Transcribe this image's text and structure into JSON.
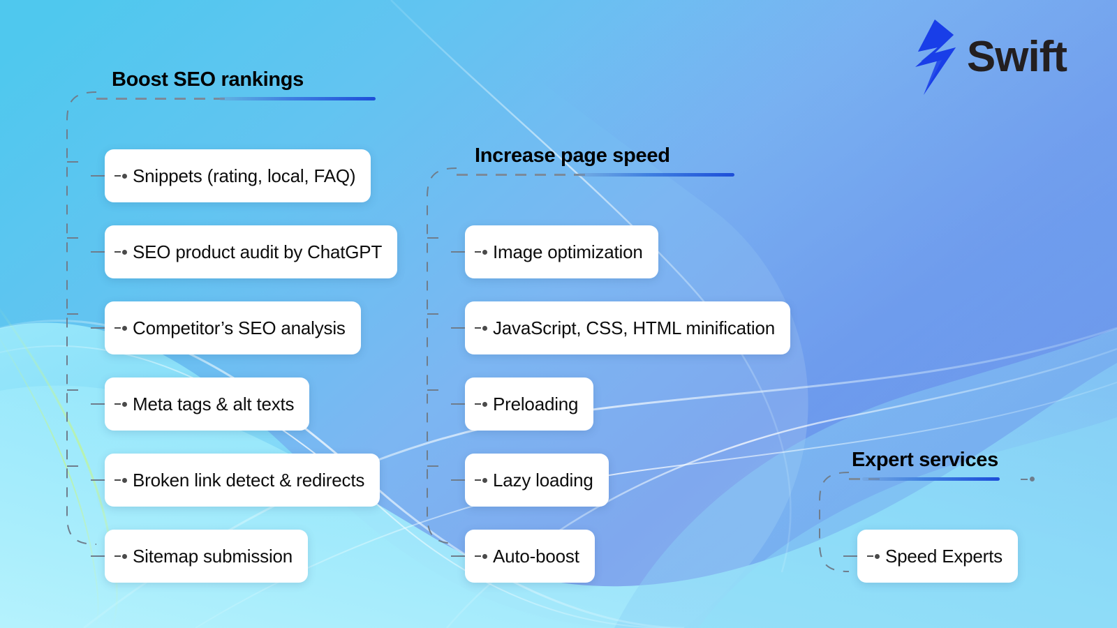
{
  "brand": {
    "name": "Swift",
    "logo_icon": "lightning-bolt-icon",
    "bolt_color": "#1A3EE8",
    "wordmark_color": "#231f20"
  },
  "theme": {
    "background_top_left": "#57C9EC",
    "background_bottom_left": "#A8ECFA",
    "background_right": "#7FAEEE",
    "accent_blue": "#1d4ed8",
    "card_background": "#FFFFFF",
    "text_color": "#0d0d0d",
    "connector_color": "#6f7d8c"
  },
  "groups": [
    {
      "id": "boost-seo-rankings",
      "title": "Boost SEO rankings",
      "items": [
        {
          "label": "Snippets (rating, local, FAQ)"
        },
        {
          "label": "SEO product audit by ChatGPT"
        },
        {
          "label": "Competitor’s SEO analysis"
        },
        {
          "label": "Meta tags & alt texts"
        },
        {
          "label": "Broken link detect & redirects"
        },
        {
          "label": "Sitemap submission"
        }
      ]
    },
    {
      "id": "increase-page-speed",
      "title": "Increase page speed",
      "items": [
        {
          "label": "Image optimization"
        },
        {
          "label": "JavaScript, CSS, HTML minification"
        },
        {
          "label": "Preloading"
        },
        {
          "label": "Lazy loading"
        },
        {
          "label": "Auto-boost"
        }
      ]
    },
    {
      "id": "expert-services",
      "title": "Expert services",
      "items": [
        {
          "label": "Speed Experts"
        }
      ]
    }
  ]
}
